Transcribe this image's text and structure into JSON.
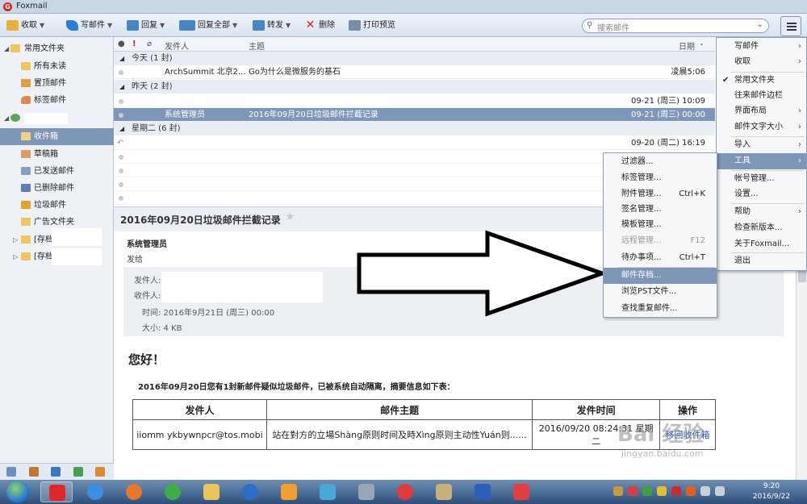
{
  "window": {
    "title": "Foxmail"
  },
  "toolbar": {
    "receive": "收取",
    "compose": "写邮件",
    "reply": "回复",
    "reply_all": "回复全部",
    "forward": "转发",
    "delete": "删除",
    "print": "打印预览",
    "search_placeholder": "搜索邮件"
  },
  "sidebar": {
    "favorites": "常用文件夹",
    "all_unread": "所有未读",
    "pinned": "置顶邮件",
    "tagged": "标签邮件",
    "inbox": "收件箱",
    "drafts": "草稿箱",
    "sent": "已发送邮件",
    "deleted": "已删除邮件",
    "junk": "垃圾邮件",
    "ads": "广告文件夹",
    "archive1": "[存档",
    "archive2": "[存档"
  },
  "list": {
    "col_from": "发件人",
    "col_subject": "主题",
    "col_date": "日期",
    "groups": [
      "今天 (1 封)",
      "昨天 (2 封)",
      "星期二 (6 封)"
    ],
    "rows": [
      {
        "from": "ArchSummit 北京2...",
        "subject": "Go为什么是微服务的基石",
        "date": "凌晨5:06"
      },
      {
        "from": "",
        "subject": "",
        "date": "09-21 (周三) 10:09"
      },
      {
        "from": "系统管理员",
        "subject": "2016年09月20日垃圾邮件拦截记录",
        "date": "09-21 (周三) 00:00"
      },
      {
        "from": "",
        "subject": "",
        "date": "09-20 (周二) 16:19"
      }
    ]
  },
  "preview": {
    "title": "2016年09月20日垃圾邮件拦截记录",
    "sender": "系统管理员",
    "sent_to": "发给",
    "from_label": "发件人:",
    "to_label": "收件人:",
    "time": "时间: 2016年9月21日 (周三) 00:00",
    "size": "大小: 4 KB",
    "greeting": "您好！",
    "summary": "2016年09月20日您有1封新邮件疑似垃圾邮件，已被系统自动隔离，摘要信息如下表：",
    "table": {
      "headers": [
        "发件人",
        "邮件主题",
        "发件时间",
        "操作"
      ],
      "row": [
        "iiomm ykbywnpcr@tos.mobi",
        "站在對方的立場Shàng原则时间及時Xìng原则主动性Yuán则......",
        "2016/09/20 08:24:31 星期二",
        "移回收件箱"
      ]
    }
  },
  "main_menu": {
    "items": [
      "写邮件",
      "收取",
      "常用文件夹",
      "往来邮件边栏",
      "界面布局",
      "邮件文字大小",
      "导入",
      "工具",
      "帐号管理...",
      "设置...",
      "帮助",
      "检查新版本...",
      "关于Foxmail...",
      "退出"
    ]
  },
  "tools_menu": {
    "items": [
      {
        "label": "过滤器...",
        "key": ""
      },
      {
        "label": "标签管理...",
        "key": ""
      },
      {
        "label": "附件管理...",
        "key": "Ctrl+K"
      },
      {
        "label": "签名管理...",
        "key": ""
      },
      {
        "label": "模板管理...",
        "key": ""
      },
      {
        "label": "远程管理...",
        "key": "F12"
      },
      {
        "label": "待办事项...",
        "key": "Ctrl+T"
      },
      {
        "label": "邮件存档...",
        "key": ""
      },
      {
        "label": "浏览PST文件...",
        "key": ""
      },
      {
        "label": "查找重复邮件...",
        "key": ""
      }
    ]
  },
  "taskbar": {
    "time": "9:20",
    "date": "2016/9/22"
  },
  "watermark": {
    "brand": "Bai 经验",
    "url": "jingyan.baidu.com"
  },
  "colors": {
    "selection": "#7e96b8",
    "accent": "#2b7fd3"
  }
}
